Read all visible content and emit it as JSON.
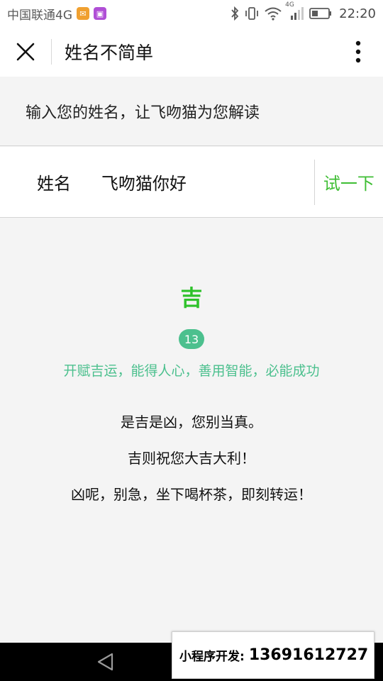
{
  "status_bar": {
    "carrier": "中国联通4G",
    "network": "4G",
    "time": "22:20"
  },
  "header": {
    "title": "姓名不简单",
    "close_icon": "close-icon",
    "more_icon": "more-vertical-icon"
  },
  "instruction": "输入您的姓名，让飞吻猫为您解读",
  "form": {
    "label": "姓名",
    "value": "飞吻猫你好",
    "button": "试一下"
  },
  "result": {
    "verdict": "吉",
    "score": "13",
    "summary": "开赋吉运，能得人心，善用智能，必能成功",
    "lines": [
      "是吉是凶，您别当真。",
      "吉则祝您大吉大利！",
      "凶呢，别急，坐下喝杯茶，即刻转运！"
    ]
  },
  "colors": {
    "accent_green": "#3fbe34",
    "verdict_green": "#2ec22b",
    "teal": "#4cc08e"
  },
  "overlay": {
    "text": "小程序开发:",
    "phone": "13691612727"
  }
}
